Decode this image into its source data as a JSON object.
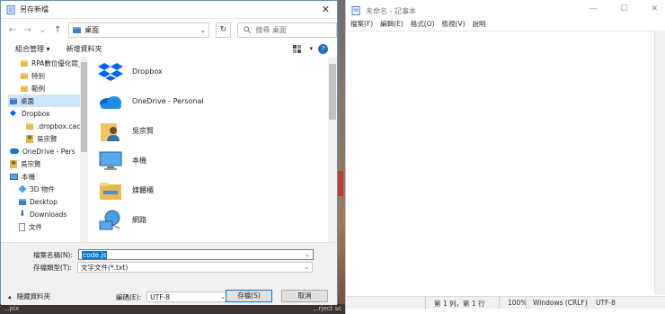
{
  "dialog": {
    "title": "另存新檔",
    "close_label": "✕",
    "address": "桌面",
    "search_placeholder": "搜尋 桌面",
    "organize": "組合管理 ▾",
    "new_folder": "新增資料夾",
    "help": "?",
    "nav_items": [
      {
        "label": "RPA數位優化競_",
        "icon": "folder"
      },
      {
        "label": "特別",
        "icon": "folder"
      },
      {
        "label": "範例",
        "icon": "folder"
      },
      {
        "label": "桌面",
        "icon": "folder-blue"
      },
      {
        "label": "Dropbox",
        "icon": "dropbox"
      },
      {
        "label": ".dropbox.cach",
        "icon": "folder"
      },
      {
        "label": "吳宗賢",
        "icon": "person"
      },
      {
        "label": "OneDrive - Pers",
        "icon": "cloud"
      },
      {
        "label": "吳宗賢",
        "icon": "person"
      },
      {
        "label": "本機",
        "icon": "pc"
      },
      {
        "label": "3D 物件",
        "icon": "cube"
      },
      {
        "label": "Desktop",
        "icon": "folder-blue"
      },
      {
        "label": "Downloads",
        "icon": "download"
      },
      {
        "label": "文件",
        "icon": "doc"
      }
    ],
    "content_items": [
      {
        "label": "Dropbox",
        "icon": "dropbox"
      },
      {
        "label": "OneDrive - Personal",
        "icon": "cloud"
      },
      {
        "label": "吳宗賢",
        "icon": "person"
      },
      {
        "label": "本機",
        "icon": "pc"
      },
      {
        "label": "媒體櫃",
        "icon": "library"
      },
      {
        "label": "網路",
        "icon": "network"
      }
    ],
    "filename_label": "檔案名稱(N):",
    "filename_value": "code.js",
    "filetype_label": "存檔類型(T):",
    "filetype_value": "文字文件(*.txt)",
    "hide_folders": "隱藏資料夾",
    "encoding_label": "編碼(E):",
    "encoding_value": "UTF-8",
    "save_button": "存檔(S)",
    "cancel_button": "取消"
  },
  "notepad": {
    "title": "未命名 - 記事本",
    "menu": [
      "檔案(F)",
      "編輯(E)",
      "格式(O)",
      "檢視(V)",
      "說明"
    ],
    "status_position": "第 1 列，第 1 行",
    "status_zoom": "100%",
    "status_eol": "Windows (CRLF)",
    "status_encoding": "UTF-8"
  },
  "taskbar": {
    "left_text": "...pix",
    "mid_text": "...rject sc"
  },
  "colors": {
    "accent": "#0078d7",
    "selection": "#cce4f7"
  }
}
